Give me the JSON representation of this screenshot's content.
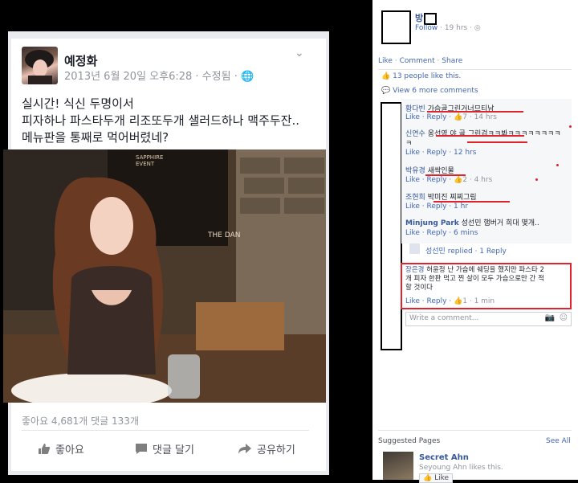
{
  "post": {
    "author": "예정화",
    "meta": "2013년 6월 20일 오후6:28 · 수정됨 · ",
    "text": "실시간! 식신 두명이서\n피자하나 파스타두개 리조또두개 샐러드하나 맥주두잔..\n메뉴판을 통째로 먹어버렸네?",
    "photo_sign": "SAPPHIRE\nEVENT",
    "photo_sign2": "THE DAN",
    "stats": "좋아요 4,681개   댓글 133개",
    "actions": {
      "like": "좋아요",
      "comment": "댓글 달기",
      "share": "공유하기"
    }
  },
  "right": {
    "page_name": "방",
    "follow": "Follow",
    "time": "· 19 hrs ·",
    "actions": [
      "Like",
      "Comment",
      "Share"
    ],
    "likes": "13 people like this.",
    "view_more": "View 6 more comments",
    "comments": [
      {
        "name": "황다빈",
        "text": "가슴골그린거너므티남",
        "meta": "Like · Reply · ",
        "likes": "7",
        "time": " · 14 hrs"
      },
      {
        "name": "신연수",
        "text": "옹선영 야 골 그린검ㅋㅋ봐ㅋㅋㅋㅋㅋㅋㅋㅋ",
        "text2": "ㅋ",
        "meta": "Like · Reply · 12 hrs"
      },
      {
        "name": "박유경",
        "text": "새싹인물",
        "meta": "Like · Reply · ",
        "likes": "2",
        "time": " · 4 hrs"
      },
      {
        "name": "조현희",
        "text": "박미진 찌찌그림",
        "meta": "Like · Reply · 1 hr"
      },
      {
        "name": "Minjung Park",
        "text": "성선민 햄버거 희대 몇개..",
        "meta": "Like · Reply · 6 mins"
      }
    ],
    "reply": {
      "name": "성선민",
      "text": "replied · 1 Reply"
    },
    "highlight": {
      "name": "장은경",
      "text": "허윤정 난 가슴에 쉐딩을 했지만 파스타 2\n개 피자 한판 먹고 찐 살이 모두 가슴으로만 간 적\n할 것이다",
      "meta": "Like · Reply · ",
      "likes": "1",
      "time": " · 1 min"
    },
    "write_placeholder": "Write a comment...",
    "suggested": {
      "title": "Suggested Pages",
      "see_all": "See All",
      "page": "Secret Ahn",
      "liked": "Seyoung Ahn likes this.",
      "like_btn": "Like"
    }
  },
  "colors": {
    "fb_blue": "#4267b2",
    "link": "#365899",
    "red": "#e0232d"
  }
}
